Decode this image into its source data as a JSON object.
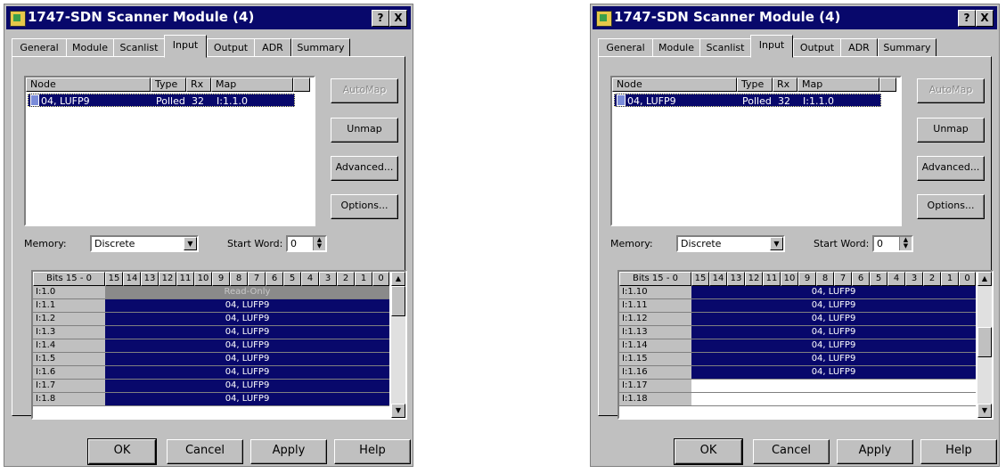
{
  "dialogs": [
    {
      "title": "1747-SDN Scanner Module (4)",
      "title_buttons": {
        "help": "?",
        "close": "X"
      },
      "tabs": [
        "General",
        "Module",
        "Scanlist",
        "Input",
        "Output",
        "ADR",
        "Summary"
      ],
      "active_tab": "Input",
      "list": {
        "columns": [
          "Node",
          "Type",
          "Rx",
          "Map"
        ],
        "rows": [
          {
            "node": "04, LUFP9",
            "type": "Polled",
            "rx": "32",
            "map": "I:1.1.0"
          }
        ]
      },
      "side_buttons": [
        "AutoMap",
        "Unmap",
        "Advanced...",
        "Options..."
      ],
      "memory_label": "Memory:",
      "memory_value": "Discrete",
      "start_word_label": "Start Word:",
      "start_word_value": "0",
      "grid": {
        "header_label": "Bits 15 - 0",
        "bit_headers": [
          "15",
          "14",
          "13",
          "12",
          "11",
          "10",
          "9",
          "8",
          "7",
          "6",
          "5",
          "4",
          "3",
          "2",
          "1",
          "0"
        ],
        "rows": [
          {
            "label": "I:1.0",
            "value": "Read-Only",
            "state": "readonly"
          },
          {
            "label": "I:1.1",
            "value": "04, LUFP9",
            "state": "mapped"
          },
          {
            "label": "I:1.2",
            "value": "04, LUFP9",
            "state": "mapped"
          },
          {
            "label": "I:1.3",
            "value": "04, LUFP9",
            "state": "mapped"
          },
          {
            "label": "I:1.4",
            "value": "04, LUFP9",
            "state": "mapped"
          },
          {
            "label": "I:1.5",
            "value": "04, LUFP9",
            "state": "mapped"
          },
          {
            "label": "I:1.6",
            "value": "04, LUFP9",
            "state": "mapped"
          },
          {
            "label": "I:1.7",
            "value": "04, LUFP9",
            "state": "mapped"
          },
          {
            "label": "I:1.8",
            "value": "04, LUFP9",
            "state": "mapped"
          }
        ]
      },
      "footer_buttons": [
        "OK",
        "Cancel",
        "Apply",
        "Help"
      ]
    },
    {
      "title": "1747-SDN Scanner Module (4)",
      "title_buttons": {
        "help": "?",
        "close": "X"
      },
      "tabs": [
        "General",
        "Module",
        "Scanlist",
        "Input",
        "Output",
        "ADR",
        "Summary"
      ],
      "active_tab": "Input",
      "list": {
        "columns": [
          "Node",
          "Type",
          "Rx",
          "Map"
        ],
        "rows": [
          {
            "node": "04, LUFP9",
            "type": "Polled",
            "rx": "32",
            "map": "I:1.1.0"
          }
        ]
      },
      "side_buttons": [
        "AutoMap",
        "Unmap",
        "Advanced...",
        "Options..."
      ],
      "memory_label": "Memory:",
      "memory_value": "Discrete",
      "start_word_label": "Start Word:",
      "start_word_value": "0",
      "grid": {
        "header_label": "Bits 15 - 0",
        "bit_headers": [
          "15",
          "14",
          "13",
          "12",
          "11",
          "10",
          "9",
          "8",
          "7",
          "6",
          "5",
          "4",
          "3",
          "2",
          "1",
          "0"
        ],
        "rows": [
          {
            "label": "I:1.10",
            "value": "04, LUFP9",
            "state": "mapped"
          },
          {
            "label": "I:1.11",
            "value": "04, LUFP9",
            "state": "mapped"
          },
          {
            "label": "I:1.12",
            "value": "04, LUFP9",
            "state": "mapped"
          },
          {
            "label": "I:1.13",
            "value": "04, LUFP9",
            "state": "mapped"
          },
          {
            "label": "I:1.14",
            "value": "04, LUFP9",
            "state": "mapped"
          },
          {
            "label": "I:1.15",
            "value": "04, LUFP9",
            "state": "mapped"
          },
          {
            "label": "I:1.16",
            "value": "04, LUFP9",
            "state": "mapped"
          },
          {
            "label": "I:1.17",
            "value": "",
            "state": "empty"
          },
          {
            "label": "I:1.18",
            "value": "",
            "state": "empty"
          }
        ]
      },
      "footer_buttons": [
        "OK",
        "Cancel",
        "Apply",
        "Help"
      ]
    }
  ],
  "colors": {
    "selection": "#08086b",
    "face": "#c0c0c0",
    "readonly": "#8a8a8a"
  }
}
